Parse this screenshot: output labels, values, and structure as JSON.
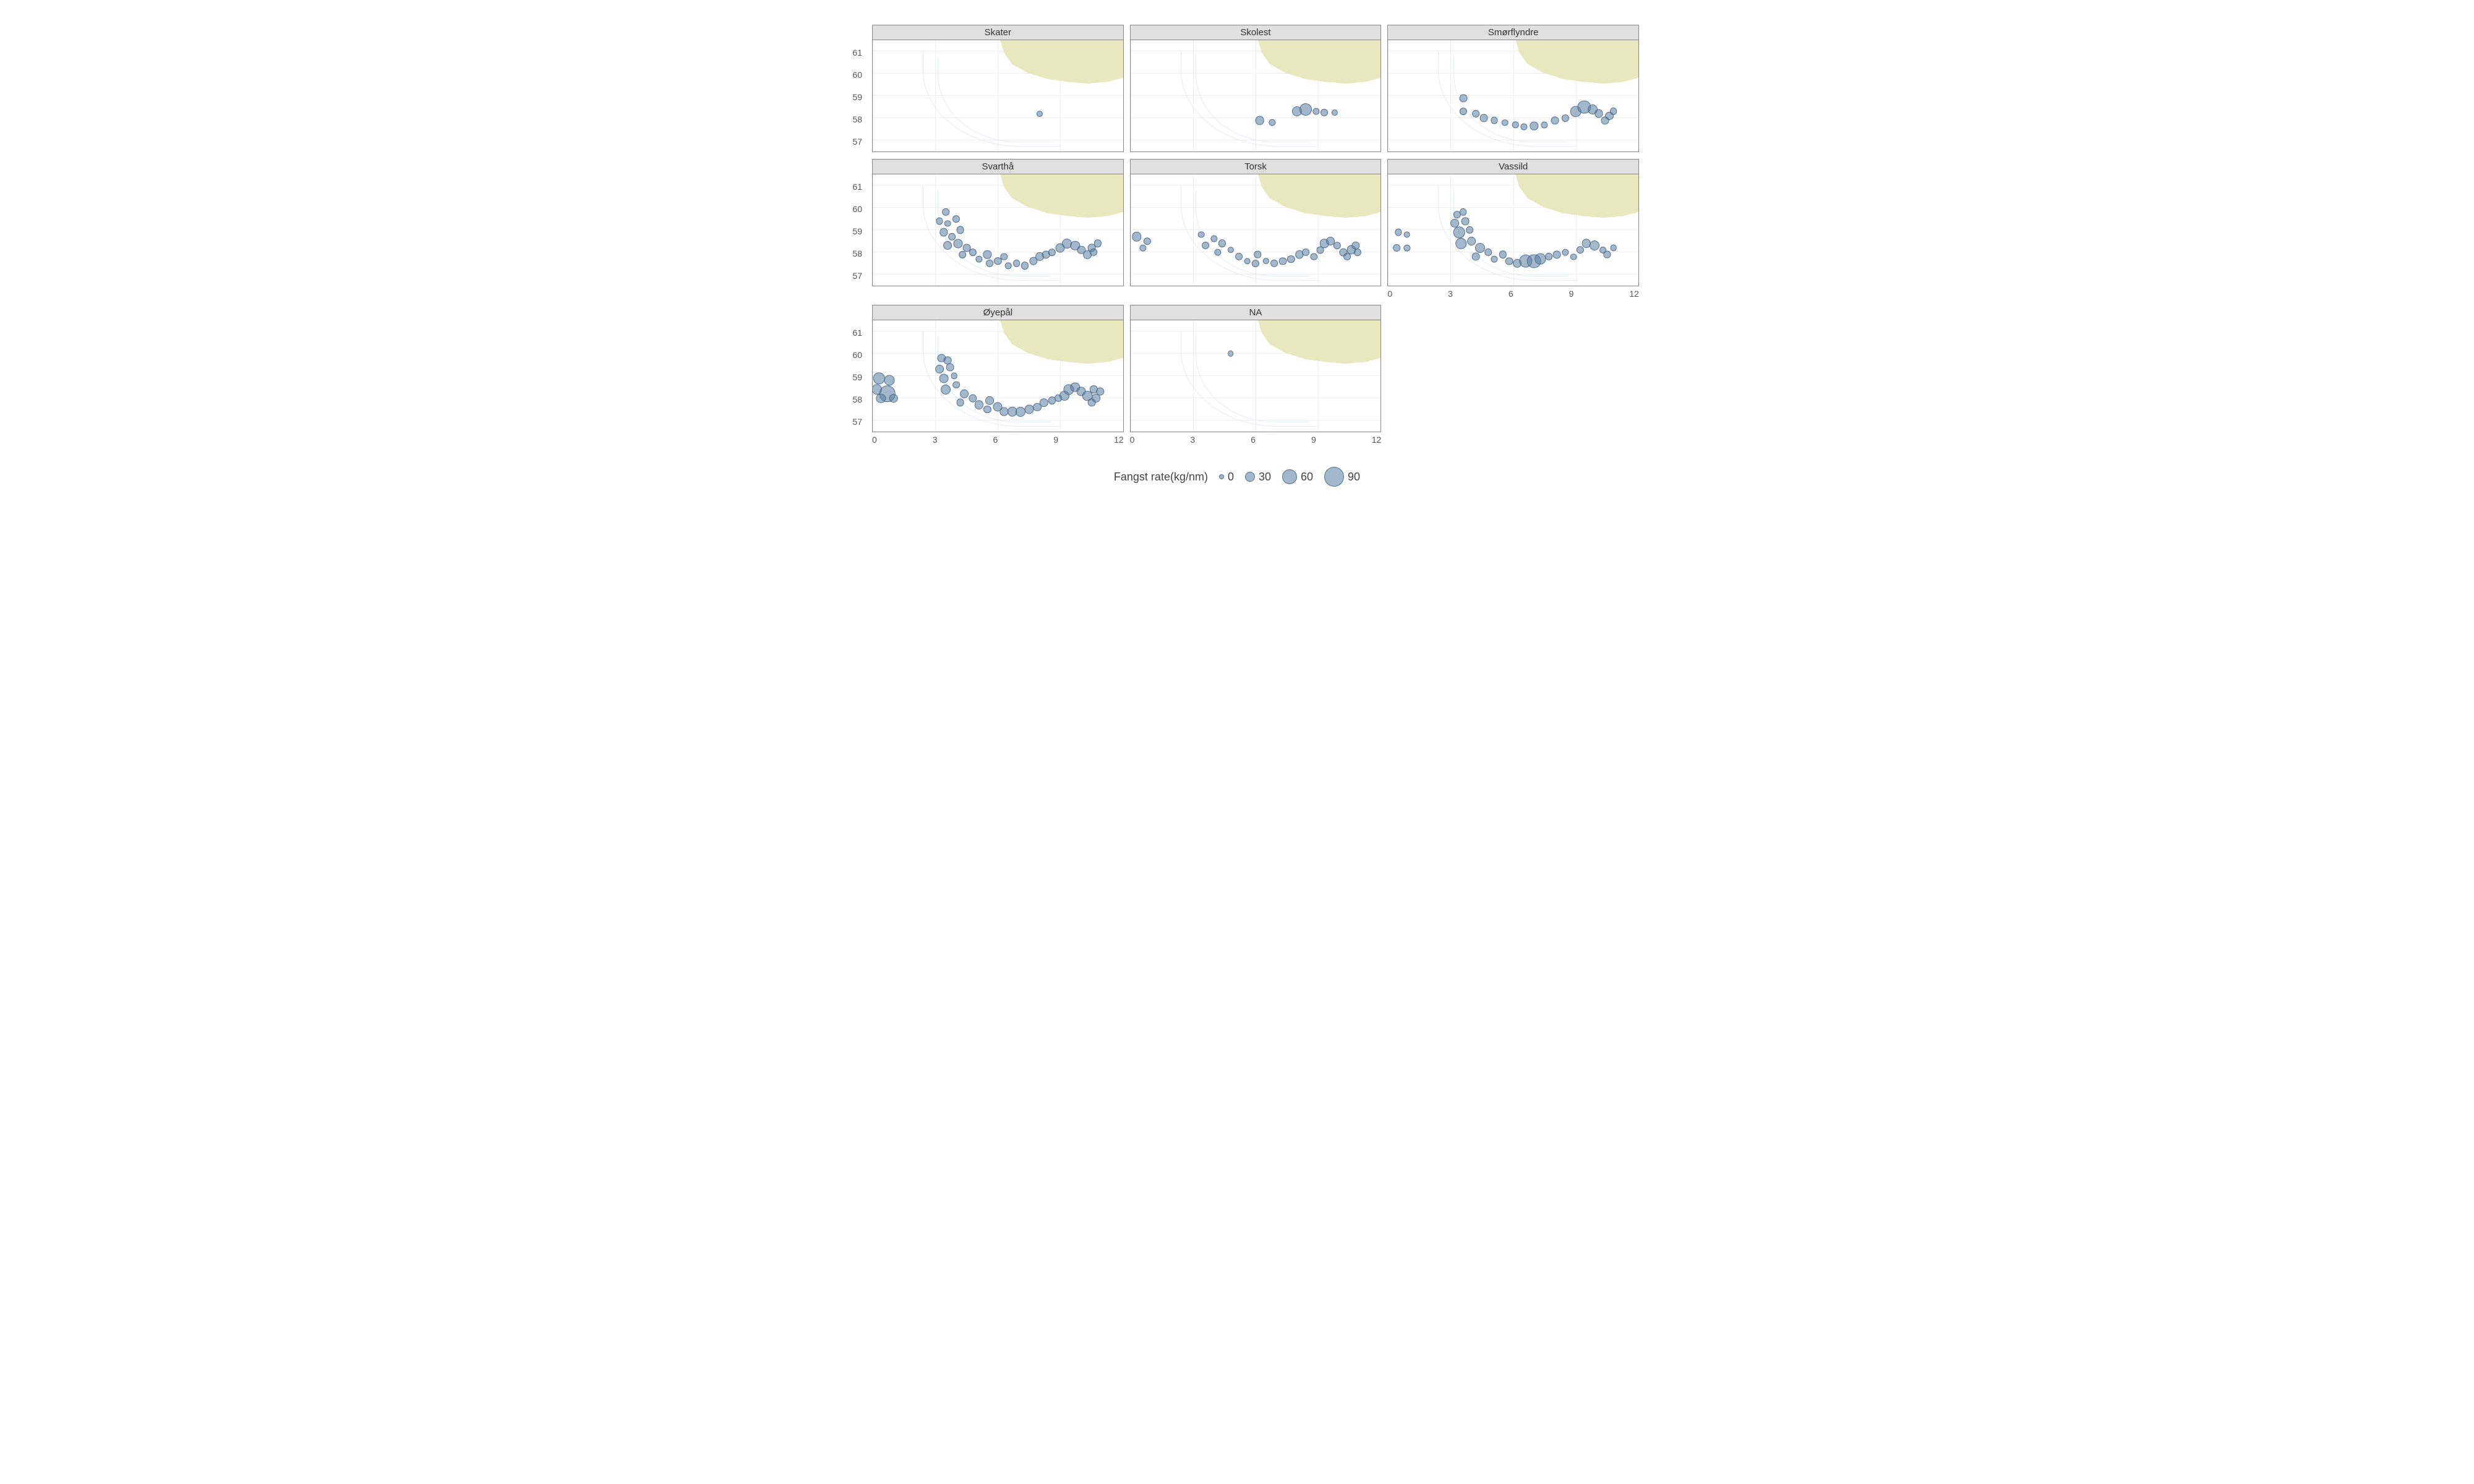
{
  "chart_data": {
    "type": "scatter",
    "facet_var": "species",
    "x_range": [
      0,
      12
    ],
    "y_range": [
      56.5,
      61.5
    ],
    "x_ticks": [
      0,
      3,
      6,
      9,
      12
    ],
    "y_ticks": [
      57,
      58,
      59,
      60,
      61
    ],
    "size_var": "Fangst rate(kg/nm)",
    "size_legend_values": [
      0,
      30,
      60,
      90
    ],
    "facets": [
      {
        "name": "Skater",
        "points": [
          {
            "x": 8.0,
            "y": 58.2,
            "size": 8
          }
        ]
      },
      {
        "name": "Skolest",
        "points": [
          {
            "x": 6.2,
            "y": 57.9,
            "size": 25
          },
          {
            "x": 6.8,
            "y": 57.8,
            "size": 12
          },
          {
            "x": 8.0,
            "y": 58.3,
            "size": 30
          },
          {
            "x": 8.4,
            "y": 58.4,
            "size": 45
          },
          {
            "x": 8.9,
            "y": 58.3,
            "size": 12
          },
          {
            "x": 9.3,
            "y": 58.25,
            "size": 15
          },
          {
            "x": 9.8,
            "y": 58.25,
            "size": 8
          }
        ]
      },
      {
        "name": "Smørflyndre",
        "points": [
          {
            "x": 3.6,
            "y": 58.9,
            "size": 18
          },
          {
            "x": 3.6,
            "y": 58.3,
            "size": 16
          },
          {
            "x": 4.2,
            "y": 58.2,
            "size": 14
          },
          {
            "x": 4.6,
            "y": 58.0,
            "size": 18
          },
          {
            "x": 5.1,
            "y": 57.9,
            "size": 12
          },
          {
            "x": 5.6,
            "y": 57.8,
            "size": 10
          },
          {
            "x": 6.1,
            "y": 57.7,
            "size": 10
          },
          {
            "x": 6.5,
            "y": 57.6,
            "size": 12
          },
          {
            "x": 7.0,
            "y": 57.65,
            "size": 20
          },
          {
            "x": 7.5,
            "y": 57.7,
            "size": 12
          },
          {
            "x": 8.0,
            "y": 57.9,
            "size": 18
          },
          {
            "x": 8.5,
            "y": 58.0,
            "size": 16
          },
          {
            "x": 9.0,
            "y": 58.3,
            "size": 40
          },
          {
            "x": 9.4,
            "y": 58.5,
            "size": 50
          },
          {
            "x": 9.8,
            "y": 58.4,
            "size": 30
          },
          {
            "x": 10.1,
            "y": 58.2,
            "size": 20
          },
          {
            "x": 10.4,
            "y": 57.9,
            "size": 18
          },
          {
            "x": 10.6,
            "y": 58.1,
            "size": 22
          },
          {
            "x": 10.8,
            "y": 58.3,
            "size": 14
          }
        ]
      },
      {
        "name": "Svarthå",
        "points": [
          {
            "x": 3.5,
            "y": 59.8,
            "size": 14
          },
          {
            "x": 3.2,
            "y": 59.4,
            "size": 12
          },
          {
            "x": 3.6,
            "y": 59.3,
            "size": 10
          },
          {
            "x": 4.0,
            "y": 59.5,
            "size": 16
          },
          {
            "x": 3.4,
            "y": 58.9,
            "size": 20
          },
          {
            "x": 3.8,
            "y": 58.7,
            "size": 14
          },
          {
            "x": 4.2,
            "y": 59.0,
            "size": 18
          },
          {
            "x": 3.6,
            "y": 58.3,
            "size": 22
          },
          {
            "x": 4.1,
            "y": 58.4,
            "size": 26
          },
          {
            "x": 4.5,
            "y": 58.2,
            "size": 18
          },
          {
            "x": 4.3,
            "y": 57.9,
            "size": 14
          },
          {
            "x": 4.8,
            "y": 58.0,
            "size": 16
          },
          {
            "x": 5.1,
            "y": 57.7,
            "size": 12
          },
          {
            "x": 5.5,
            "y": 57.9,
            "size": 20
          },
          {
            "x": 5.6,
            "y": 57.5,
            "size": 14
          },
          {
            "x": 6.0,
            "y": 57.6,
            "size": 16
          },
          {
            "x": 6.3,
            "y": 57.8,
            "size": 12
          },
          {
            "x": 6.5,
            "y": 57.4,
            "size": 10
          },
          {
            "x": 6.9,
            "y": 57.5,
            "size": 14
          },
          {
            "x": 7.3,
            "y": 57.4,
            "size": 16
          },
          {
            "x": 7.7,
            "y": 57.6,
            "size": 20
          },
          {
            "x": 8.0,
            "y": 57.8,
            "size": 22
          },
          {
            "x": 8.3,
            "y": 57.9,
            "size": 18
          },
          {
            "x": 8.6,
            "y": 58.0,
            "size": 16
          },
          {
            "x": 9.0,
            "y": 58.2,
            "size": 26
          },
          {
            "x": 9.3,
            "y": 58.4,
            "size": 30
          },
          {
            "x": 9.7,
            "y": 58.3,
            "size": 28
          },
          {
            "x": 10.0,
            "y": 58.1,
            "size": 20
          },
          {
            "x": 10.3,
            "y": 57.9,
            "size": 22
          },
          {
            "x": 10.5,
            "y": 58.2,
            "size": 18
          },
          {
            "x": 10.8,
            "y": 58.4,
            "size": 16
          },
          {
            "x": 10.6,
            "y": 58.0,
            "size": 14
          }
        ]
      },
      {
        "name": "Torsk",
        "points": [
          {
            "x": 0.3,
            "y": 58.7,
            "size": 28
          },
          {
            "x": 0.8,
            "y": 58.5,
            "size": 16
          },
          {
            "x": 0.6,
            "y": 58.2,
            "size": 12
          },
          {
            "x": 3.4,
            "y": 58.8,
            "size": 10
          },
          {
            "x": 3.6,
            "y": 58.3,
            "size": 14
          },
          {
            "x": 4.0,
            "y": 58.6,
            "size": 12
          },
          {
            "x": 4.4,
            "y": 58.4,
            "size": 16
          },
          {
            "x": 4.2,
            "y": 58.0,
            "size": 12
          },
          {
            "x": 4.8,
            "y": 58.1,
            "size": 8
          },
          {
            "x": 5.2,
            "y": 57.8,
            "size": 14
          },
          {
            "x": 5.6,
            "y": 57.6,
            "size": 10
          },
          {
            "x": 6.0,
            "y": 57.5,
            "size": 16
          },
          {
            "x": 6.1,
            "y": 57.9,
            "size": 12
          },
          {
            "x": 6.5,
            "y": 57.6,
            "size": 8
          },
          {
            "x": 6.9,
            "y": 57.5,
            "size": 14
          },
          {
            "x": 7.3,
            "y": 57.6,
            "size": 18
          },
          {
            "x": 7.7,
            "y": 57.7,
            "size": 16
          },
          {
            "x": 8.1,
            "y": 57.9,
            "size": 20
          },
          {
            "x": 8.4,
            "y": 58.0,
            "size": 14
          },
          {
            "x": 8.8,
            "y": 57.8,
            "size": 12
          },
          {
            "x": 9.1,
            "y": 58.1,
            "size": 18
          },
          {
            "x": 9.3,
            "y": 58.4,
            "size": 24
          },
          {
            "x": 9.6,
            "y": 58.5,
            "size": 22
          },
          {
            "x": 9.9,
            "y": 58.3,
            "size": 16
          },
          {
            "x": 10.2,
            "y": 58.0,
            "size": 20
          },
          {
            "x": 10.4,
            "y": 57.8,
            "size": 14
          },
          {
            "x": 10.6,
            "y": 58.1,
            "size": 26
          },
          {
            "x": 10.8,
            "y": 58.3,
            "size": 20
          },
          {
            "x": 10.9,
            "y": 58.0,
            "size": 16
          }
        ]
      },
      {
        "name": "Vassild",
        "points": [
          {
            "x": 0.5,
            "y": 58.9,
            "size": 12
          },
          {
            "x": 0.9,
            "y": 58.8,
            "size": 10
          },
          {
            "x": 0.4,
            "y": 58.2,
            "size": 14
          },
          {
            "x": 0.9,
            "y": 58.2,
            "size": 12
          },
          {
            "x": 3.3,
            "y": 59.7,
            "size": 16
          },
          {
            "x": 3.6,
            "y": 59.8,
            "size": 14
          },
          {
            "x": 3.2,
            "y": 59.3,
            "size": 22
          },
          {
            "x": 3.7,
            "y": 59.4,
            "size": 18
          },
          {
            "x": 3.4,
            "y": 58.9,
            "size": 40
          },
          {
            "x": 3.9,
            "y": 59.0,
            "size": 14
          },
          {
            "x": 3.5,
            "y": 58.4,
            "size": 36
          },
          {
            "x": 4.0,
            "y": 58.5,
            "size": 22
          },
          {
            "x": 4.4,
            "y": 58.2,
            "size": 30
          },
          {
            "x": 4.2,
            "y": 57.8,
            "size": 18
          },
          {
            "x": 4.8,
            "y": 58.0,
            "size": 14
          },
          {
            "x": 5.1,
            "y": 57.7,
            "size": 12
          },
          {
            "x": 5.5,
            "y": 57.9,
            "size": 16
          },
          {
            "x": 5.8,
            "y": 57.6,
            "size": 18
          },
          {
            "x": 6.2,
            "y": 57.5,
            "size": 22
          },
          {
            "x": 6.6,
            "y": 57.6,
            "size": 50
          },
          {
            "x": 7.0,
            "y": 57.6,
            "size": 55
          },
          {
            "x": 7.3,
            "y": 57.7,
            "size": 35
          },
          {
            "x": 7.7,
            "y": 57.8,
            "size": 14
          },
          {
            "x": 8.1,
            "y": 57.9,
            "size": 18
          },
          {
            "x": 8.5,
            "y": 58.0,
            "size": 12
          },
          {
            "x": 8.9,
            "y": 57.8,
            "size": 10
          },
          {
            "x": 9.2,
            "y": 58.1,
            "size": 16
          },
          {
            "x": 9.5,
            "y": 58.4,
            "size": 24
          },
          {
            "x": 9.9,
            "y": 58.3,
            "size": 30
          },
          {
            "x": 10.3,
            "y": 58.1,
            "size": 14
          },
          {
            "x": 10.5,
            "y": 57.9,
            "size": 12
          },
          {
            "x": 10.8,
            "y": 58.2,
            "size": 10
          }
        ]
      },
      {
        "name": "Øyepål",
        "points": [
          {
            "x": 0.3,
            "y": 58.9,
            "size": 40
          },
          {
            "x": 0.8,
            "y": 58.8,
            "size": 34
          },
          {
            "x": 0.2,
            "y": 58.4,
            "size": 32
          },
          {
            "x": 0.7,
            "y": 58.2,
            "size": 70
          },
          {
            "x": 0.4,
            "y": 58.0,
            "size": 28
          },
          {
            "x": 1.0,
            "y": 58.0,
            "size": 24
          },
          {
            "x": 3.3,
            "y": 59.8,
            "size": 20
          },
          {
            "x": 3.6,
            "y": 59.7,
            "size": 18
          },
          {
            "x": 3.2,
            "y": 59.3,
            "size": 22
          },
          {
            "x": 3.7,
            "y": 59.4,
            "size": 18
          },
          {
            "x": 3.4,
            "y": 58.9,
            "size": 26
          },
          {
            "x": 3.9,
            "y": 59.0,
            "size": 10
          },
          {
            "x": 3.5,
            "y": 58.4,
            "size": 30
          },
          {
            "x": 4.0,
            "y": 58.6,
            "size": 14
          },
          {
            "x": 4.4,
            "y": 58.2,
            "size": 22
          },
          {
            "x": 4.2,
            "y": 57.8,
            "size": 18
          },
          {
            "x": 4.8,
            "y": 58.0,
            "size": 20
          },
          {
            "x": 5.1,
            "y": 57.7,
            "size": 24
          },
          {
            "x": 5.5,
            "y": 57.5,
            "size": 16
          },
          {
            "x": 5.6,
            "y": 57.9,
            "size": 22
          },
          {
            "x": 6.0,
            "y": 57.6,
            "size": 26
          },
          {
            "x": 6.3,
            "y": 57.4,
            "size": 20
          },
          {
            "x": 6.7,
            "y": 57.4,
            "size": 28
          },
          {
            "x": 7.1,
            "y": 57.4,
            "size": 30
          },
          {
            "x": 7.5,
            "y": 57.5,
            "size": 26
          },
          {
            "x": 7.9,
            "y": 57.6,
            "size": 22
          },
          {
            "x": 8.2,
            "y": 57.8,
            "size": 24
          },
          {
            "x": 8.6,
            "y": 57.9,
            "size": 16
          },
          {
            "x": 8.9,
            "y": 58.0,
            "size": 14
          },
          {
            "x": 9.2,
            "y": 58.1,
            "size": 30
          },
          {
            "x": 9.4,
            "y": 58.4,
            "size": 34
          },
          {
            "x": 9.7,
            "y": 58.5,
            "size": 28
          },
          {
            "x": 10.0,
            "y": 58.3,
            "size": 26
          },
          {
            "x": 10.3,
            "y": 58.1,
            "size": 32
          },
          {
            "x": 10.5,
            "y": 57.8,
            "size": 18
          },
          {
            "x": 10.7,
            "y": 58.0,
            "size": 22
          },
          {
            "x": 10.9,
            "y": 58.3,
            "size": 20
          },
          {
            "x": 10.6,
            "y": 58.4,
            "size": 16
          }
        ]
      },
      {
        "name": "NA",
        "points": [
          {
            "x": 4.8,
            "y": 60.0,
            "size": 6
          }
        ]
      }
    ]
  },
  "legend": {
    "title": "Fangst rate(kg/nm)",
    "items": [
      {
        "label": "0",
        "px": 6
      },
      {
        "label": "30",
        "px": 14
      },
      {
        "label": "60",
        "px": 22
      },
      {
        "label": "90",
        "px": 30
      }
    ]
  },
  "colors": {
    "bubble_fill": "rgba(90,125,160,0.55)",
    "bubble_stroke": "rgba(70,100,135,0.85)",
    "land": "#e6e5b8"
  }
}
